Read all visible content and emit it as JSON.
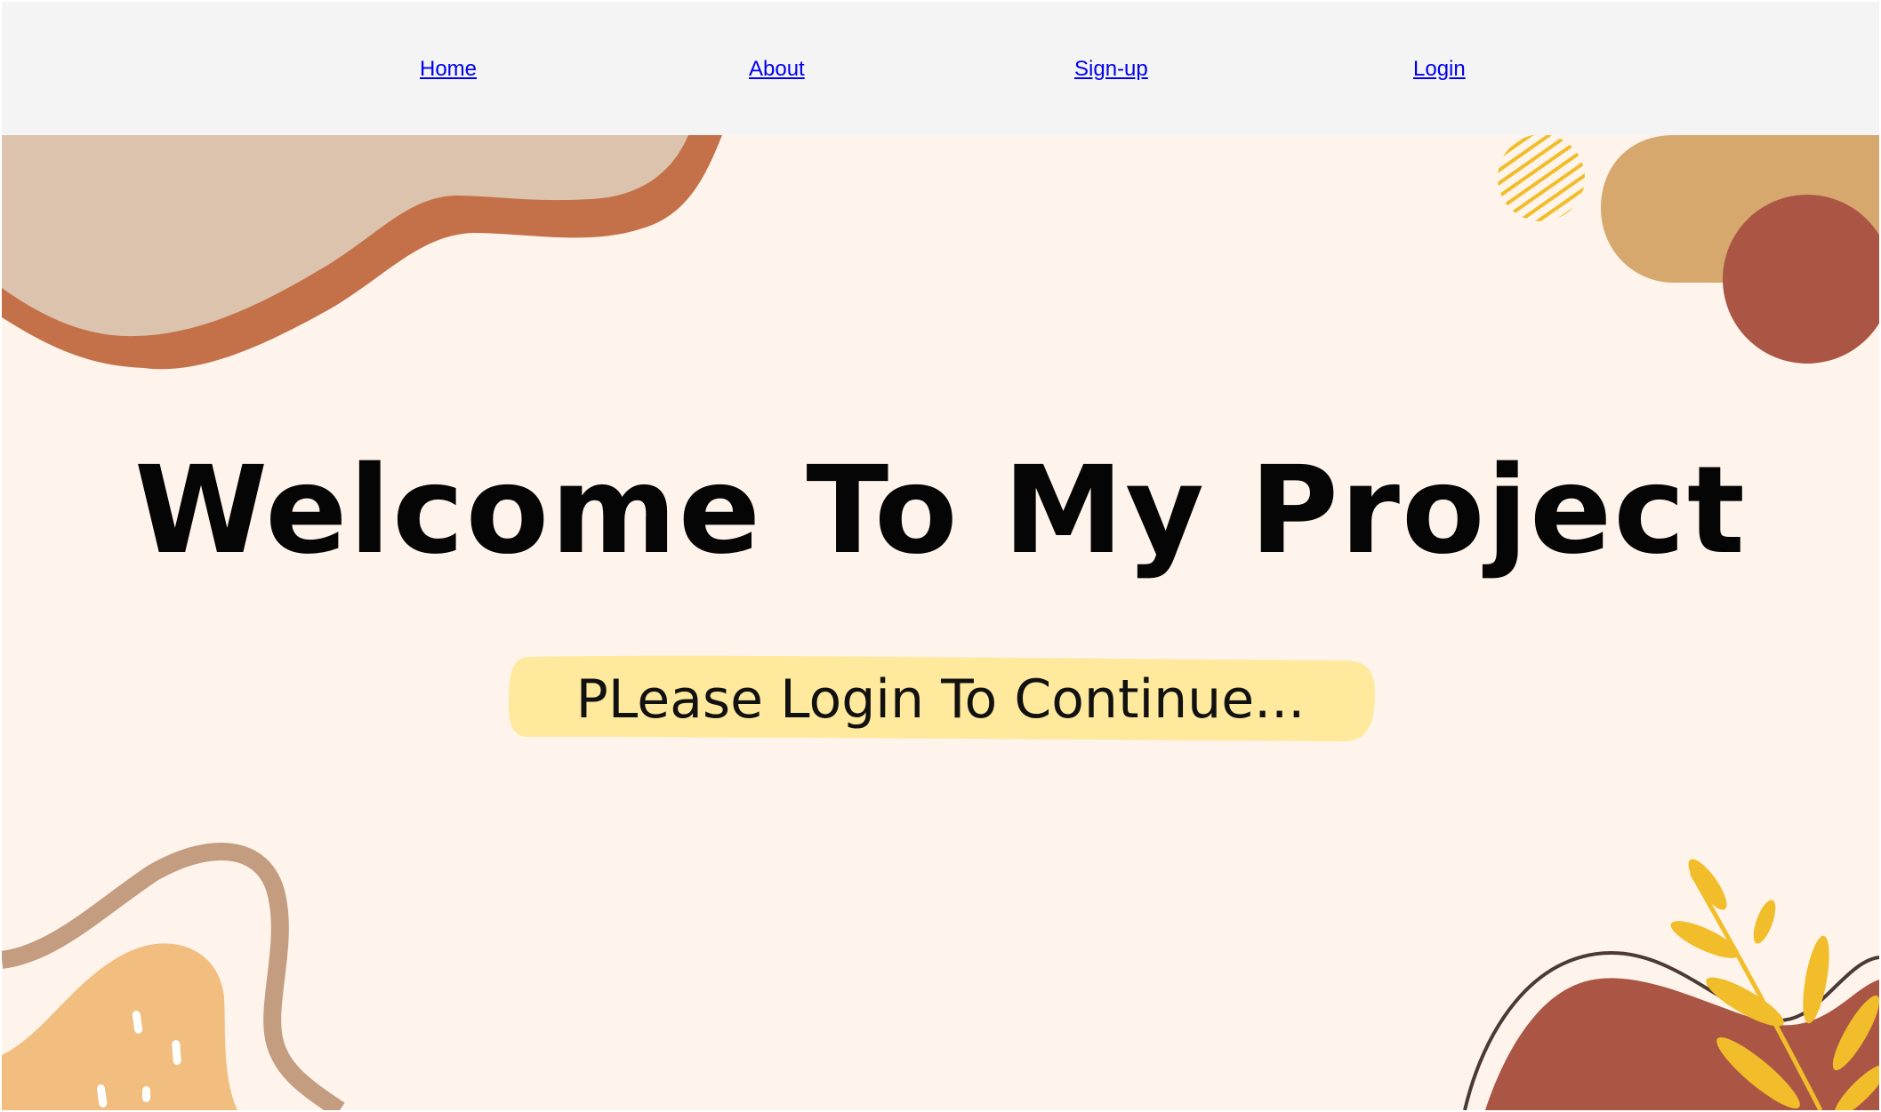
{
  "nav": {
    "items": [
      {
        "label": "Home"
      },
      {
        "label": "About"
      },
      {
        "label": "Sign-up"
      },
      {
        "label": "Login"
      }
    ],
    "link_color": "#0000ee",
    "background": "#f4f4f4"
  },
  "hero": {
    "title": "Welcome To My Project",
    "subtitle": "PLease Login To Continue...",
    "background": "#fef4ec",
    "highlight_color": "#ffe99d"
  },
  "palette": {
    "beige": "#dcc3ad",
    "terracotta": "#c4714a",
    "sand": "#d6a86e",
    "rust": "#ab5645",
    "peach": "#f1be80",
    "tan_line": "#c49c80",
    "mustard": "#f2bd2a",
    "dark_line": "#4a3a33"
  }
}
